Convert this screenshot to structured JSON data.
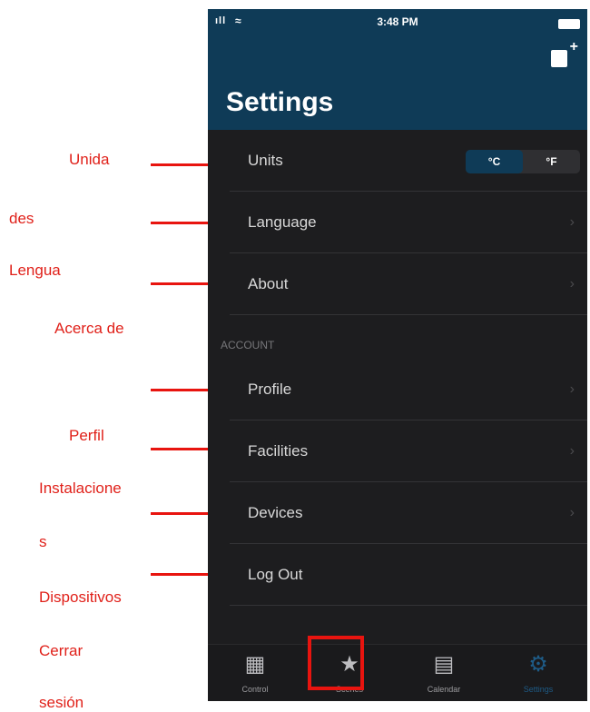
{
  "annotations": [
    "Unida",
    "des",
    "Lengua",
    "Acerca de",
    "Perfil",
    "Instalacione",
    "s",
    "Dispositivos",
    "Cerrar",
    "sesión"
  ],
  "status": {
    "time": "3:48 PM",
    "signal": "ıll",
    "wifi": "≈"
  },
  "header": {
    "title": "Settings",
    "add_device_plus": "+"
  },
  "settings": {
    "units_label": "Units",
    "units_options": [
      "°C",
      "°F"
    ],
    "selected_unit": "°C",
    "language_label": "Language",
    "about_label": "About"
  },
  "account": {
    "section_label": "ACCOUNT",
    "profile_label": "Profile",
    "facilities_label": "Facilities",
    "devices_label": "Devices",
    "logout_label": "Log Out"
  },
  "chevron": "›",
  "tabs": [
    {
      "label": "Control",
      "icon": "grid-icon",
      "glyph": "▦"
    },
    {
      "label": "Scenes",
      "icon": "star-icon",
      "glyph": "★"
    },
    {
      "label": "Calendar",
      "icon": "calendar-icon",
      "glyph": "▤"
    },
    {
      "label": "Settings",
      "icon": "gear-icon",
      "glyph": "⚙",
      "active": true
    }
  ],
  "colors": {
    "header": "#0f3b57",
    "background": "#1d1d1f",
    "annotation": "#e0211a",
    "accent": "#1e5b86"
  }
}
